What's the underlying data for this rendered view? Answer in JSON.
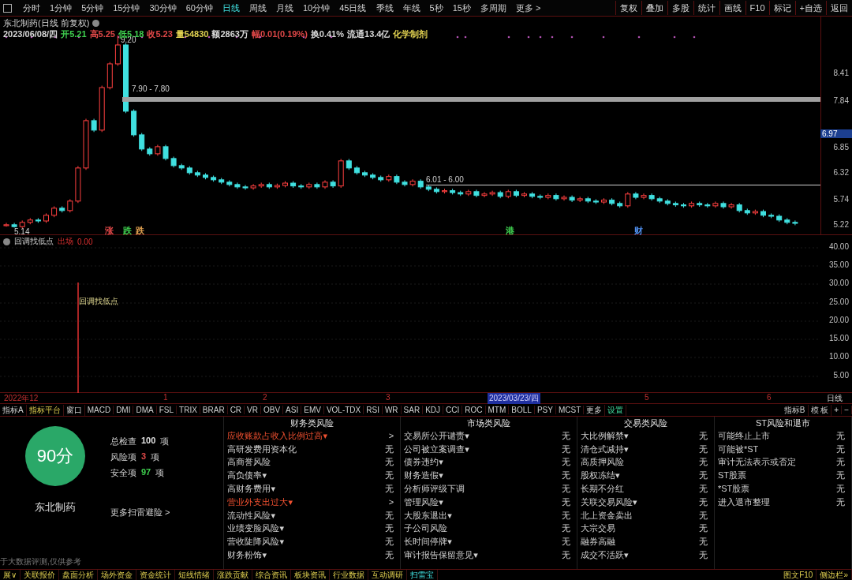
{
  "toolbar": {
    "periods": [
      {
        "label": "分时",
        "selected": false
      },
      {
        "label": "1分钟",
        "selected": false
      },
      {
        "label": "5分钟",
        "selected": false
      },
      {
        "label": "15分钟",
        "selected": false
      },
      {
        "label": "30分钟",
        "selected": false
      },
      {
        "label": "60分钟",
        "selected": false
      },
      {
        "label": "日线",
        "selected": true
      },
      {
        "label": "周线",
        "selected": false
      },
      {
        "label": "月线",
        "selected": false
      },
      {
        "label": "10分钟",
        "selected": false
      },
      {
        "label": "45日线",
        "selected": false
      },
      {
        "label": "季线",
        "selected": false
      },
      {
        "label": "年线",
        "selected": false
      },
      {
        "label": "5秒",
        "selected": false
      },
      {
        "label": "15秒",
        "selected": false
      },
      {
        "label": "多周期",
        "selected": false
      },
      {
        "label": "更多 >",
        "selected": false
      }
    ],
    "actions": [
      "复权",
      "叠加",
      "多股",
      "统计",
      "画线",
      "F10",
      "标记",
      "+自选",
      "返回"
    ]
  },
  "chart": {
    "title": "东北制药(日线 前复权)",
    "quote": [
      {
        "text": "2023/06/08/四",
        "color": "#d8d8d8"
      },
      {
        "text": "开5.21",
        "color": "#3fd04f"
      },
      {
        "text": "高5.25",
        "color": "#e04848"
      },
      {
        "text": "低5.18",
        "color": "#3fd04f"
      },
      {
        "text": "收5.23",
        "color": "#e04848"
      },
      {
        "text": "量54830",
        "color": "#e0d050"
      },
      {
        "text": "额2863万",
        "color": "#d8d8d8"
      },
      {
        "text": "幅0.01(0.19%)",
        "color": "#e04848"
      },
      {
        "text": "换0.41%",
        "color": "#d8d8d8"
      },
      {
        "text": "流通13.4亿",
        "color": "#d8d8d8"
      },
      {
        "text": "化学制剂",
        "color": "#e0d050"
      }
    ],
    "high_label": "9.20",
    "low_label": "5.14",
    "band_label": "7.90 - 7.80",
    "line_label": "6.01 - 6.00",
    "markers": [
      {
        "text": "涨",
        "color": "#e04848"
      },
      {
        "text": "跌",
        "color": "#3fd04f"
      },
      {
        "text": "跌",
        "color": "#e0a050"
      },
      {
        "text": "港",
        "color": "#3fd04f"
      },
      {
        "text": "财",
        "color": "#5090f0"
      }
    ],
    "current_price": "6.97",
    "chart_data": {
      "type": "candlestick",
      "ylim": [
        4.98,
        9.6
      ],
      "yticks": [
        5.22,
        5.74,
        6.32,
        6.85,
        7.84,
        8.41
      ],
      "ohlc": [
        [
          5.18,
          5.24,
          5.16,
          5.2
        ],
        [
          5.2,
          5.24,
          5.14,
          5.16
        ],
        [
          5.16,
          5.29,
          5.12,
          5.25
        ],
        [
          5.25,
          5.34,
          5.21,
          5.3
        ],
        [
          5.3,
          5.34,
          5.24,
          5.28
        ],
        [
          5.28,
          5.44,
          5.24,
          5.4
        ],
        [
          5.4,
          5.59,
          5.36,
          5.55
        ],
        [
          5.55,
          5.59,
          5.46,
          5.5
        ],
        [
          5.5,
          5.74,
          5.46,
          5.7
        ],
        [
          5.7,
          6.44,
          5.66,
          6.4
        ],
        [
          6.4,
          7.44,
          6.36,
          7.4
        ],
        [
          7.4,
          7.44,
          7.16,
          7.2
        ],
        [
          7.2,
          8.14,
          7.16,
          8.1
        ],
        [
          8.1,
          8.64,
          8.06,
          8.6
        ],
        [
          8.6,
          9.2,
          8.56,
          9.0
        ],
        [
          9.0,
          9.04,
          7.56,
          7.6
        ],
        [
          7.6,
          7.64,
          7.06,
          7.1
        ],
        [
          7.1,
          7.14,
          6.76,
          6.8
        ],
        [
          6.8,
          6.84,
          6.66,
          6.7
        ],
        [
          6.7,
          6.89,
          6.66,
          6.85
        ],
        [
          6.85,
          6.89,
          6.56,
          6.6
        ],
        [
          6.6,
          6.64,
          6.41,
          6.45
        ],
        [
          6.45,
          6.49,
          6.36,
          6.4
        ],
        [
          6.4,
          6.44,
          6.26,
          6.3
        ],
        [
          6.3,
          6.34,
          6.21,
          6.25
        ],
        [
          6.25,
          6.29,
          6.16,
          6.2
        ],
        [
          6.2,
          6.24,
          6.11,
          6.15
        ],
        [
          6.15,
          6.19,
          6.06,
          6.1
        ],
        [
          6.1,
          6.14,
          6.01,
          6.05
        ],
        [
          6.05,
          6.09,
          5.96,
          6.0
        ],
        [
          6.0,
          6.04,
          5.94,
          5.98
        ],
        [
          5.98,
          6.06,
          5.94,
          6.02
        ],
        [
          6.02,
          6.09,
          5.98,
          6.05
        ],
        [
          6.05,
          6.09,
          5.96,
          6.0
        ],
        [
          6.0,
          6.07,
          5.96,
          6.03
        ],
        [
          6.03,
          6.12,
          5.99,
          6.08
        ],
        [
          6.08,
          6.12,
          5.98,
          6.02
        ],
        [
          6.02,
          6.06,
          5.96,
          6.0
        ],
        [
          6.0,
          6.09,
          5.96,
          6.05
        ],
        [
          6.05,
          6.09,
          5.96,
          6.0
        ],
        [
          6.0,
          6.14,
          5.96,
          6.1
        ],
        [
          6.1,
          6.14,
          5.98,
          6.02
        ],
        [
          6.02,
          6.59,
          5.98,
          6.55
        ],
        [
          6.55,
          6.59,
          6.36,
          6.4
        ],
        [
          6.4,
          6.44,
          6.26,
          6.3
        ],
        [
          6.3,
          6.34,
          6.21,
          6.25
        ],
        [
          6.25,
          6.29,
          6.16,
          6.2
        ],
        [
          6.2,
          6.24,
          6.11,
          6.15
        ],
        [
          6.15,
          6.26,
          6.11,
          6.22
        ],
        [
          6.22,
          6.26,
          6.06,
          6.1
        ],
        [
          6.1,
          6.14,
          6.01,
          6.05
        ],
        [
          6.05,
          6.16,
          6.01,
          6.12
        ],
        [
          6.12,
          6.16,
          5.96,
          6.0
        ],
        [
          6.0,
          6.04,
          5.91,
          5.95
        ],
        [
          5.95,
          5.99,
          5.86,
          5.9
        ],
        [
          5.9,
          5.96,
          5.86,
          5.92
        ],
        [
          5.92,
          5.96,
          5.84,
          5.88
        ],
        [
          5.88,
          5.92,
          5.81,
          5.85
        ],
        [
          5.85,
          5.94,
          5.81,
          5.9
        ],
        [
          5.9,
          5.94,
          5.78,
          5.82
        ],
        [
          5.82,
          5.89,
          5.78,
          5.85
        ],
        [
          5.85,
          5.92,
          5.81,
          5.88
        ],
        [
          5.88,
          5.92,
          5.76,
          5.8
        ],
        [
          5.8,
          5.94,
          5.76,
          5.9
        ],
        [
          5.9,
          5.94,
          5.78,
          5.82
        ],
        [
          5.82,
          5.89,
          5.78,
          5.85
        ],
        [
          5.85,
          5.89,
          5.76,
          5.8
        ],
        [
          5.8,
          5.84,
          5.74,
          5.78
        ],
        [
          5.78,
          5.86,
          5.74,
          5.82
        ],
        [
          5.82,
          5.86,
          5.71,
          5.75
        ],
        [
          5.75,
          5.82,
          5.71,
          5.78
        ],
        [
          5.78,
          5.82,
          5.68,
          5.72
        ],
        [
          5.72,
          5.79,
          5.68,
          5.75
        ],
        [
          5.75,
          5.79,
          5.66,
          5.7
        ],
        [
          5.7,
          5.74,
          5.64,
          5.68
        ],
        [
          5.68,
          5.76,
          5.64,
          5.72
        ],
        [
          5.72,
          5.76,
          5.61,
          5.65
        ],
        [
          5.65,
          5.69,
          5.56,
          5.6
        ],
        [
          5.6,
          5.89,
          5.56,
          5.85
        ],
        [
          5.85,
          5.89,
          5.74,
          5.78
        ],
        [
          5.78,
          5.86,
          5.74,
          5.82
        ],
        [
          5.82,
          5.86,
          5.71,
          5.75
        ],
        [
          5.75,
          5.79,
          5.66,
          5.7
        ],
        [
          5.7,
          5.74,
          5.61,
          5.65
        ],
        [
          5.65,
          5.69,
          5.58,
          5.62
        ],
        [
          5.62,
          5.66,
          5.56,
          5.6
        ],
        [
          5.6,
          5.69,
          5.56,
          5.65
        ],
        [
          5.65,
          5.69,
          5.58,
          5.62
        ],
        [
          5.62,
          5.66,
          5.56,
          5.6
        ],
        [
          5.6,
          5.69,
          5.56,
          5.65
        ],
        [
          5.65,
          5.69,
          5.54,
          5.58
        ],
        [
          5.58,
          5.66,
          5.54,
          5.62
        ],
        [
          5.62,
          5.66,
          5.46,
          5.5
        ],
        [
          5.5,
          5.54,
          5.41,
          5.45
        ],
        [
          5.45,
          5.52,
          5.41,
          5.48
        ],
        [
          5.48,
          5.52,
          5.36,
          5.4
        ],
        [
          5.4,
          5.44,
          5.34,
          5.38
        ],
        [
          5.38,
          5.42,
          5.26,
          5.3
        ],
        [
          5.3,
          5.34,
          5.21,
          5.25
        ],
        [
          5.25,
          5.29,
          5.19,
          5.23
        ]
      ]
    }
  },
  "indicator": {
    "name": "回调找低点",
    "output_label": "出场",
    "output_value": "0.00",
    "signal_label": "回调找低点",
    "axis": [
      "40.00",
      "35.00",
      "30.00",
      "25.00",
      "20.00",
      "15.00",
      "10.00",
      "5.00"
    ]
  },
  "date_axis": {
    "labels": [
      {
        "text": "2022年12",
        "selected": false
      },
      {
        "text": "1",
        "selected": false
      },
      {
        "text": "2",
        "selected": false
      },
      {
        "text": "3",
        "selected": false
      },
      {
        "text": "2023/03/23/四",
        "selected": true
      },
      {
        "text": "5",
        "selected": false
      },
      {
        "text": "6",
        "selected": false
      }
    ],
    "period": "日线"
  },
  "indicator_tabs": {
    "left": [
      {
        "label": "指标A",
        "kind": "tab",
        "selected": false
      },
      {
        "label": "指标平台",
        "kind": "tab",
        "selected": true
      },
      {
        "label": "窗口",
        "kind": "tab",
        "selected": false
      },
      {
        "label": "MACD",
        "kind": "tab",
        "selected": false
      },
      {
        "label": "DMI",
        "kind": "tab",
        "selected": false
      },
      {
        "label": "DMA",
        "kind": "tab",
        "selected": false
      },
      {
        "label": "FSL",
        "kind": "tab",
        "selected": false
      },
      {
        "label": "TRIX",
        "kind": "tab",
        "selected": false
      },
      {
        "label": "BRAR",
        "kind": "tab",
        "selected": false
      },
      {
        "label": "CR",
        "kind": "tab",
        "selected": false
      },
      {
        "label": "VR",
        "kind": "tab",
        "selected": false
      },
      {
        "label": "OBV",
        "kind": "tab",
        "selected": false
      },
      {
        "label": "ASI",
        "kind": "tab",
        "selected": false
      },
      {
        "label": "EMV",
        "kind": "tab",
        "selected": false
      },
      {
        "label": "VOL-TDX",
        "kind": "tab",
        "selected": false
      },
      {
        "label": "RSI",
        "kind": "tab",
        "selected": false
      },
      {
        "label": "WR",
        "kind": "tab",
        "selected": false
      },
      {
        "label": "SAR",
        "kind": "tab",
        "selected": false
      },
      {
        "label": "KDJ",
        "kind": "tab",
        "selected": false
      },
      {
        "label": "CCI",
        "kind": "tab",
        "selected": false
      },
      {
        "label": "ROC",
        "kind": "tab",
        "selected": false
      },
      {
        "label": "MTM",
        "kind": "tab",
        "selected": false
      },
      {
        "label": "BOLL",
        "kind": "tab",
        "selected": false
      },
      {
        "label": "PSY",
        "kind": "tab",
        "selected": false
      },
      {
        "label": "MCST",
        "kind": "tab",
        "selected": false
      },
      {
        "label": "更多",
        "kind": "tab",
        "selected": false
      },
      {
        "label": "设置",
        "kind": "setting",
        "selected": false
      }
    ],
    "right": [
      "指标B",
      "模 板",
      "+",
      "−"
    ]
  },
  "risk_scan": {
    "score": "90分",
    "company": "东北制药",
    "stats": [
      {
        "label": "总检查",
        "value": "100",
        "unit": "项",
        "color": "#e0e0e0"
      },
      {
        "label": "风险项",
        "value": "3",
        "unit": "项",
        "color": "#e04848"
      },
      {
        "label": "安全项",
        "value": "97",
        "unit": "项",
        "color": "#3fd04f"
      }
    ],
    "more_link": "更多扫雷避险 >",
    "note": "于大数据评测,仅供参考",
    "categories": [
      {
        "title": "财务类风险",
        "items": [
          {
            "label": "应收账款占收入比例过高▾",
            "result": ">",
            "flagged": true
          },
          {
            "label": "高研发费用资本化",
            "result": "无",
            "flagged": false
          },
          {
            "label": "高商誉风险",
            "result": "无",
            "flagged": false
          },
          {
            "label": "高负债率▾",
            "result": "无",
            "flagged": false
          },
          {
            "label": "高财务费用▾",
            "result": "无",
            "flagged": false
          },
          {
            "label": "营业外支出过大▾",
            "result": ">",
            "flagged": true
          },
          {
            "label": "流动性风险▾",
            "result": "无",
            "flagged": false
          },
          {
            "label": "业绩变脸风险▾",
            "result": "无",
            "flagged": false
          },
          {
            "label": "营收陡降风险▾",
            "result": "无",
            "flagged": false
          },
          {
            "label": "财务粉饰▾",
            "result": "无",
            "flagged": false
          }
        ]
      },
      {
        "title": "市场类风险",
        "items": [
          {
            "label": "交易所公开谴责▾",
            "result": "无",
            "flagged": false
          },
          {
            "label": "公司被立案调查▾",
            "result": "无",
            "flagged": false
          },
          {
            "label": "债券违约▾",
            "result": "无",
            "flagged": false
          },
          {
            "label": "财务造假▾",
            "result": "无",
            "flagged": false
          },
          {
            "label": "分析师评级下调",
            "result": "无",
            "flagged": false
          },
          {
            "label": "管理风险▾",
            "result": "无",
            "flagged": false
          },
          {
            "label": "大股东退出▾",
            "result": "无",
            "flagged": false
          },
          {
            "label": "子公司风险",
            "result": "无",
            "flagged": false
          },
          {
            "label": "长时间停牌▾",
            "result": "无",
            "flagged": false
          },
          {
            "label": "审计报告保留意见▾",
            "result": "无",
            "flagged": false
          }
        ]
      },
      {
        "title": "交易类风险",
        "items": [
          {
            "label": "大比例解禁▾",
            "result": "无",
            "flagged": false
          },
          {
            "label": "清仓式减持▾",
            "result": "无",
            "flagged": false
          },
          {
            "label": "高质押风险",
            "result": "无",
            "flagged": false
          },
          {
            "label": "股权冻结▾",
            "result": "无",
            "flagged": false
          },
          {
            "label": "长期不分红",
            "result": "无",
            "flagged": false
          },
          {
            "label": "关联交易风险▾",
            "result": "无",
            "flagged": false
          },
          {
            "label": "北上资金卖出",
            "result": "无",
            "flagged": false
          },
          {
            "label": "大宗交易",
            "result": "无",
            "flagged": false
          },
          {
            "label": "融券高融",
            "result": "无",
            "flagged": false
          },
          {
            "label": "成交不活跃▾",
            "result": "无",
            "flagged": false
          }
        ]
      },
      {
        "title": "ST风险和退市",
        "items": [
          {
            "label": "可能终止上市",
            "result": "无",
            "flagged": false
          },
          {
            "label": "可能被*ST",
            "result": "无",
            "flagged": false
          },
          {
            "label": "审计无法表示或否定",
            "result": "无",
            "flagged": false
          },
          {
            "label": "ST股票",
            "result": "无",
            "flagged": false
          },
          {
            "label": "*ST股票",
            "result": "无",
            "flagged": false
          },
          {
            "label": "进入退市整理",
            "result": "无",
            "flagged": false
          }
        ]
      }
    ]
  },
  "bottom_tabs": [
    {
      "label": "展∨",
      "selected": false
    },
    {
      "label": "关联报价",
      "selected": false
    },
    {
      "label": "盘面分析",
      "selected": false
    },
    {
      "label": "场外资金",
      "selected": false
    },
    {
      "label": "资金统计",
      "selected": false
    },
    {
      "label": "短线情绪",
      "selected": false
    },
    {
      "label": "涨跌贡献",
      "selected": false
    },
    {
      "label": "综合资讯",
      "selected": false
    },
    {
      "label": "板块资讯",
      "selected": false
    },
    {
      "label": "行业数据",
      "selected": false
    },
    {
      "label": "互动调研",
      "selected": false
    },
    {
      "label": "扫雷宝",
      "selected": true
    }
  ],
  "bottom_right": [
    "图文F10",
    "侧边栏»"
  ]
}
